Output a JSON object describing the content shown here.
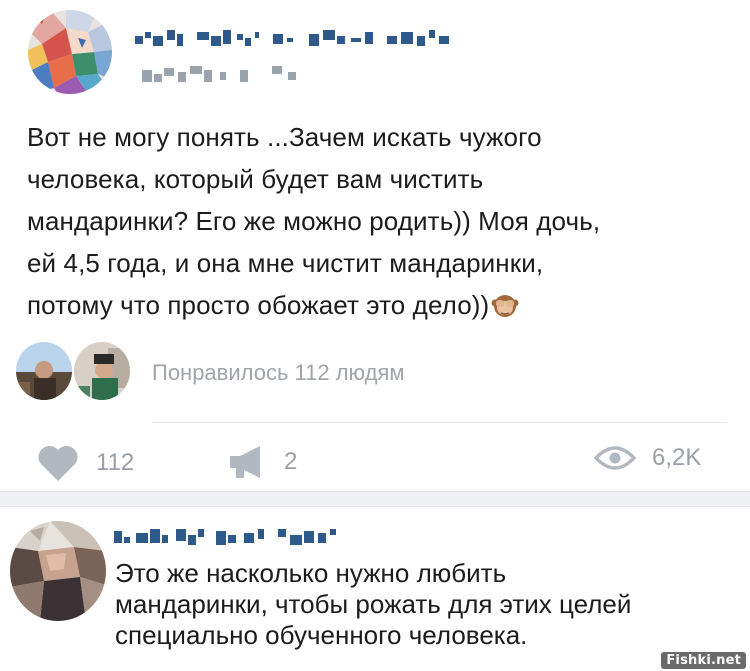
{
  "post": {
    "text_lines": [
      "Вот не могу понять ...Зачем искать чужого",
      "человека, который будет вам чистить",
      "мандаринки? Его же можно родить)) Моя дочь,",
      "ей 4,5 года, и она мне чистит мандаринки,",
      "потому что просто обожает это дело))"
    ],
    "emoji": "see-no-evil-monkey-icon",
    "liked_text": "Понравилось 112 людям",
    "actions": {
      "likes": "112",
      "reposts": "2",
      "views": "6,2K"
    }
  },
  "comment": {
    "text_lines": [
      "Это же насколько нужно любить",
      "мандаринки, чтобы рожать для этих целей",
      "специально обученного человека."
    ]
  },
  "watermark": "Fishki.net",
  "colors": {
    "text": "#1c1c1c",
    "muted": "#9aa0a7",
    "divider": "#e4e6ea",
    "separator": "#eef0f3"
  }
}
